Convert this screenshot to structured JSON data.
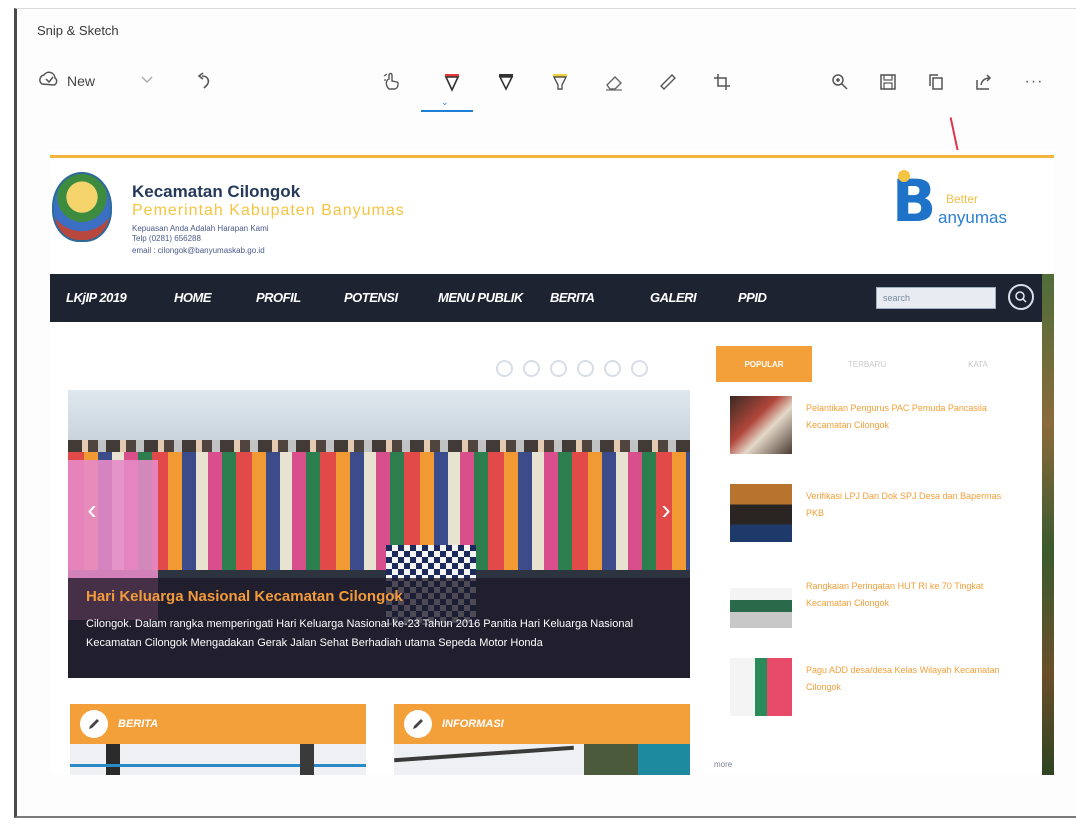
{
  "window": {
    "title": "Snip & Sketch"
  },
  "toolbar": {
    "new_label": "New",
    "icons": [
      "new-snip-icon",
      "chevron-down-icon",
      "undo-icon",
      "touch-writing-icon",
      "ballpoint-pen-icon",
      "pencil-icon",
      "highlighter-icon",
      "eraser-icon",
      "ruler-icon",
      "crop-icon",
      "zoom-icon",
      "save-icon",
      "copy-icon",
      "share-icon",
      "more-icon"
    ],
    "more_label": "···",
    "pen_chevron": "⌄"
  },
  "colors": {
    "accent": "#1e7fd6",
    "site_orange": "#f3a03a",
    "nav_dark": "#1e2332",
    "site_yellow": "#f5c542",
    "annotation_red": "#e0344a"
  },
  "site": {
    "name": "Kecamatan Cilongok",
    "org": "Pemerintah Kabupaten Banyumas",
    "tagline": "Kepuasan Anda Adalah Harapan Kami",
    "phone": "Telp (0281) 656288",
    "email": "email : cilongok@banyumaskab.go.id",
    "brand_top": "Better",
    "brand_bottom": "anyumas",
    "brand_letter": "B"
  },
  "nav": {
    "items": [
      "LKjIP 2019",
      "HOME",
      "PROFIL",
      "POTENSI",
      "MENU PUBLIK",
      "BERITA",
      "GALERI",
      "PPID"
    ],
    "search_placeholder": "search"
  },
  "slider": {
    "dot_count": 6,
    "prev": "‹",
    "next": "›",
    "title": "Hari Keluarga Nasional Kecamatan Cilongok",
    "text": "Cilongok. Dalam rangka memperingati Hari Keluarga Nasional ke-23 Tahun 2016 Panitia Hari Keluarga Nasional Kecamatan Cilongok Mengadakan Gerak Jalan Sehat Berhadiah utama Sepeda Motor Honda"
  },
  "sidebar": {
    "tabs": [
      "POPULAR",
      "TERBARU",
      "KATA"
    ],
    "items": [
      "Pelantikan Pengurus PAC Pemuda Pancasila Kecamatan Cilongok",
      "Verifikasi LPJ Dan Dok SPJ Desa dan Bapermas PKB",
      "Rangkaian Peringatan HUT RI ke 70 Tingkat Kecamatan Cilongok",
      "Pagu ADD desa/desa Kelas Wilayah Kecamatan Cilongok"
    ],
    "more": "more"
  },
  "panels": {
    "berita": "BERITA",
    "informasi": "INFORMASI"
  }
}
